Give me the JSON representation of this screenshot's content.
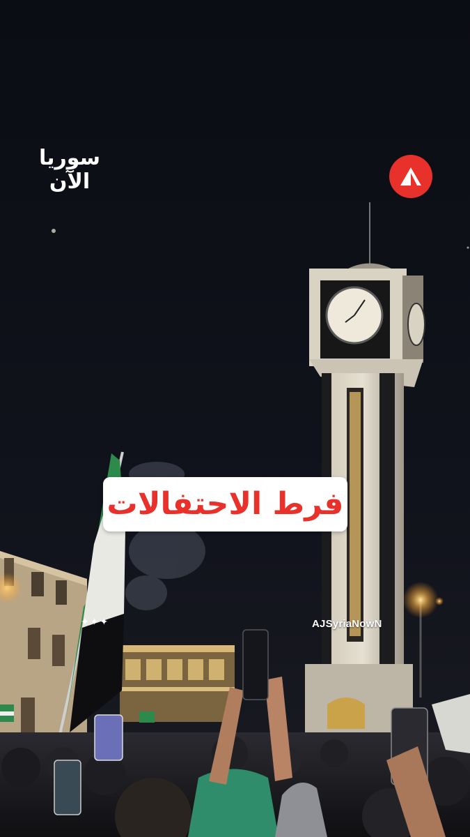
{
  "brand": {
    "logo_line1": "سوريا",
    "logo_line2": "الآن",
    "accent_color": "#e8312a",
    "badge_icon": "aljazeera-triangle-icon"
  },
  "headline": {
    "text": "فرط الاحتفالات"
  },
  "watermark": {
    "handle": "AJSyriaNowN",
    "sparkles": "✦✦✦"
  },
  "scene": {
    "description_icons": [
      "clock-tower",
      "crowd",
      "revolution-flag",
      "street-lamp",
      "buildings"
    ]
  }
}
